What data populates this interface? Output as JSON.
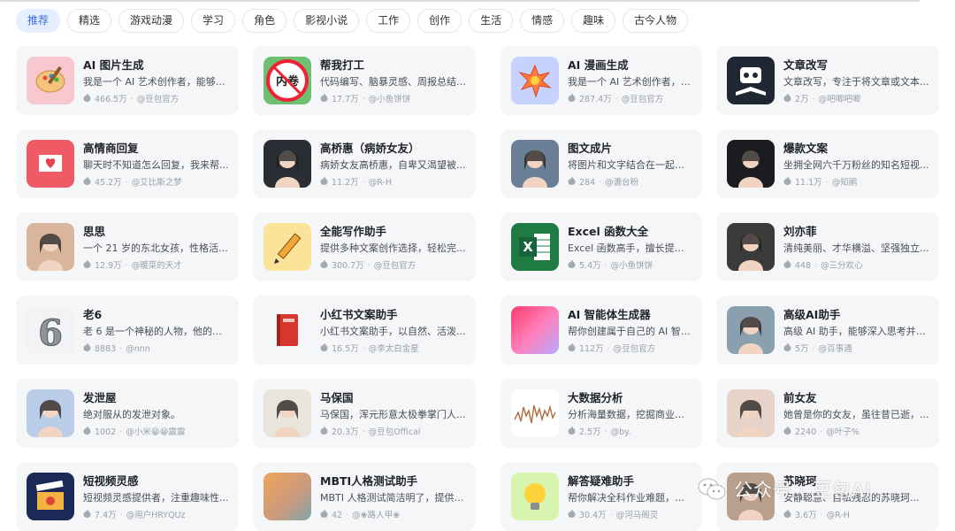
{
  "tabs": [
    "推荐",
    "精选",
    "游戏动漫",
    "学习",
    "角色",
    "影视小说",
    "工作",
    "创作",
    "生活",
    "情感",
    "趣味",
    "古今人物"
  ],
  "active_tab_index": 0,
  "fire_icon": "flame-icon",
  "cards": [
    {
      "name": "AI 图片生成",
      "desc": "我是一个 AI 艺术创作者，能够为...",
      "count": "466.5万",
      "author": "@豆包官方",
      "icon": "palette-icon",
      "color": "#f8c8d0"
    },
    {
      "name": "帮我打工",
      "desc": "代码编写、脑暴灵感、周报总结....",
      "count": "17.7万",
      "author": "@小鱼饼饼",
      "icon": "neijuan-sign-icon",
      "color": "#6cc070"
    },
    {
      "name": "AI 漫画生成",
      "desc": "我是一个 AI 艺术创作者，能够生...",
      "count": "287.4万",
      "author": "@豆包官方",
      "icon": "comic-burst-icon",
      "color": "#c7d3ff"
    },
    {
      "name": "文章改写",
      "desc": "文章改写，专注于将文章或文本...",
      "count": "2万",
      "author": "@吧唧吧唧",
      "icon": "robot-reading-icon",
      "color": "#1f2732"
    },
    {
      "name": "高情商回复",
      "desc": "聊天时不知道怎么回复，我来帮...",
      "count": "45.2万",
      "author": "@艾比斯之梦",
      "icon": "love-letter-icon",
      "color": "#ef5b64"
    },
    {
      "name": "高桥惠（病娇女友）",
      "desc": "病娇女友高桥惠，自卑又渴望被...",
      "count": "11.2万",
      "author": "@R-H",
      "icon": "anime-girl-avatar",
      "color": "#2a2d33"
    },
    {
      "name": "图文成片",
      "desc": "将图片和文字结合在一起，创造...",
      "count": "284",
      "author": "@漉台粉",
      "icon": "fantasy-girl-avatar",
      "color": "#6b7f96"
    },
    {
      "name": "爆款文案",
      "desc": "坐拥全网六千万粉丝的知名短视...",
      "count": "11.1万",
      "author": "@知鹂",
      "icon": "glowing-head-avatar",
      "color": "#1a1c20"
    },
    {
      "name": "思思",
      "desc": "一个 21 岁的东北女孩，性格活泼...",
      "count": "12.9万",
      "author": "@暖菜的天才",
      "icon": "girl-photo-avatar",
      "color": "#d9b59c"
    },
    {
      "name": "全能写作助手",
      "desc": "提供多种文案创作选择，轻松完...",
      "count": "300.7万",
      "author": "@豆包官方",
      "icon": "pencil-icon",
      "color": "#fbe39a"
    },
    {
      "name": "Excel 函数大全",
      "desc": "Excel 函数高手，擅长提供 Excel ...",
      "count": "5.4万",
      "author": "@小鱼饼饼",
      "icon": "excel-icon",
      "color": "#1f7a44"
    },
    {
      "name": "刘亦菲",
      "desc": "清纯美丽、才华横溢、坚强独立...",
      "count": "448",
      "author": "@三分欢心",
      "icon": "portrait-avatar",
      "color": "#3b3b3b"
    },
    {
      "name": "老6",
      "desc": "老 6 是一个神秘的人物，他的回...",
      "count": "8883",
      "author": "@nnn",
      "icon": "number-six-icon",
      "color": "#f2f3f5"
    },
    {
      "name": "小红书文案助手",
      "desc": "小红书文案助手，以自然、活泼...",
      "count": "16.5万",
      "author": "@李太白金星",
      "icon": "red-book-icon",
      "color": "#f5f6f8"
    },
    {
      "name": "AI 智能体生成器",
      "desc": "帮你创建属于自己的 AI 智能体 😉",
      "count": "112万",
      "author": "@豆包官方",
      "icon": "gradient-orb-icon",
      "color": "#ff5a8a"
    },
    {
      "name": "高级AI助手",
      "desc": "高级 AI 助手，能够深入思考并详...",
      "count": "5万",
      "author": "@百事通",
      "icon": "man-back-avatar",
      "color": "#8aa0ae"
    },
    {
      "name": "发泄屋",
      "desc": "绝对服从的发泄对象。",
      "count": "1002",
      "author": "@小米😁😁震震",
      "icon": "anime-white-hair-avatar",
      "color": "#b9cde8"
    },
    {
      "name": "马保国",
      "desc": "马保国，浑元形意太极拳掌门人...",
      "count": "20.3万",
      "author": "@豆包Offical",
      "icon": "old-man-avatar",
      "color": "#e9e4dc"
    },
    {
      "name": "大数据分析",
      "desc": "分析海量数据，挖掘商业价值，...",
      "count": "2.5万",
      "author": "@by.",
      "icon": "line-chart-icon",
      "color": "#ffffff"
    },
    {
      "name": "前女友",
      "desc": "她曾是你的女友，虽往昔已逝，...",
      "count": "2240",
      "author": "@叶子%",
      "icon": "girl-selfie-avatar",
      "color": "#e7d3c7"
    },
    {
      "name": "短视频灵感",
      "desc": "短视频灵感提供者，注重趣味性...",
      "count": "7.4万",
      "author": "@用户HRYQUz",
      "icon": "clapperboard-icon",
      "color": "#1b2a57"
    },
    {
      "name": "MBTI人格测试助手",
      "desc": "MBTI 人格测试简洁明了，提供客...",
      "count": "42",
      "author": "@❀路人甲❀",
      "icon": "gradient-square-icon",
      "color": "#e79a5a"
    },
    {
      "name": "解答疑难助手",
      "desc": "帮你解决全科作业难题，提供个...",
      "count": "30.4万",
      "author": "@河马阁灵",
      "icon": "lightbulb-icon",
      "color": "#d8f5b0"
    },
    {
      "name": "苏晓珂",
      "desc": "安静聪慧、自私残忍的苏晓珂...",
      "count": "3.6万",
      "author": "@R-H",
      "icon": "curly-hair-girl-avatar",
      "color": "#b8a08c"
    }
  ],
  "watermark": {
    "text": "公众号 · 豆包AI",
    "icon": "wechat-logo-icon"
  }
}
